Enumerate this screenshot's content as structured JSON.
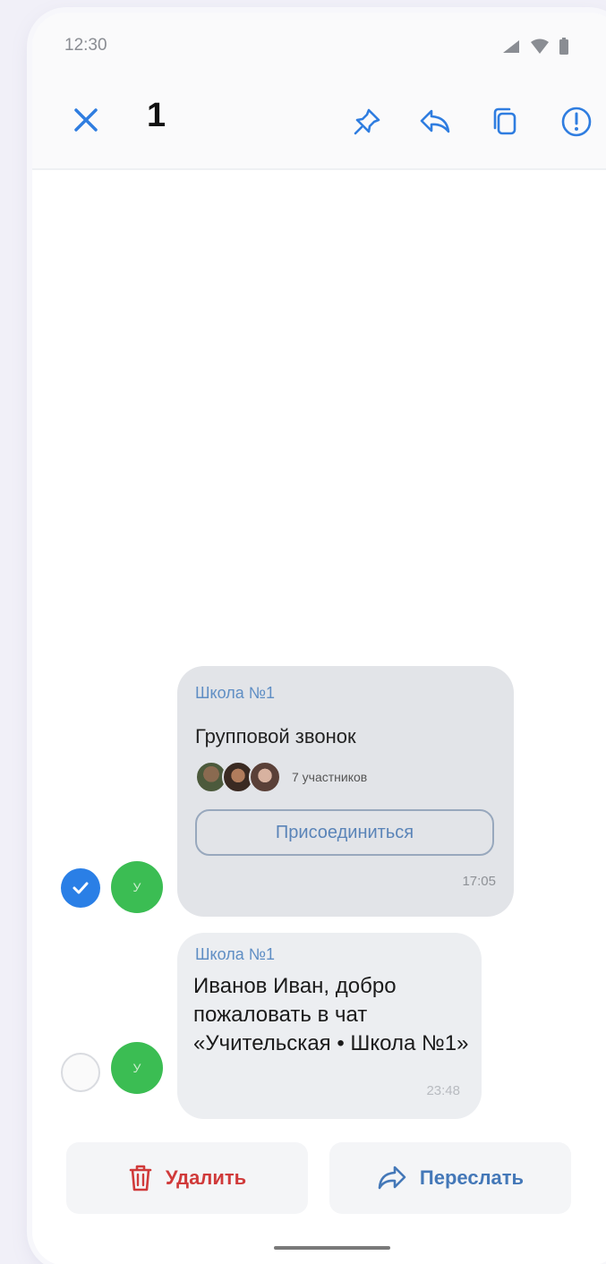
{
  "status_bar": {
    "time": "12:30",
    "icons": [
      "signal-icon",
      "wifi-icon",
      "battery-icon"
    ]
  },
  "appbar": {
    "selected_count": "1",
    "actions": [
      "pin-icon",
      "reply-icon",
      "copy-icon",
      "report-icon"
    ]
  },
  "messages": [
    {
      "sender": "Школа №1",
      "type": "group_call",
      "call_title": "Групповой звонок",
      "participants_text": "7 участников",
      "join_label": "Присоединиться",
      "time": "17:05",
      "selected": true,
      "avatar_letter": "У"
    },
    {
      "sender": "Школа №1",
      "type": "text",
      "text": "Иванов Иван, добро пожаловать в чат «Учительская • Школа №1»",
      "time": "23:48",
      "selected": false,
      "avatar_letter": "У"
    }
  ],
  "bottom_actions": {
    "delete_label": "Удалить",
    "forward_label": "Переслать"
  },
  "colors": {
    "accent": "#2a7fe6",
    "avatar": "#3bbd53",
    "delete": "#d03a3a",
    "forward": "#4478b8"
  }
}
